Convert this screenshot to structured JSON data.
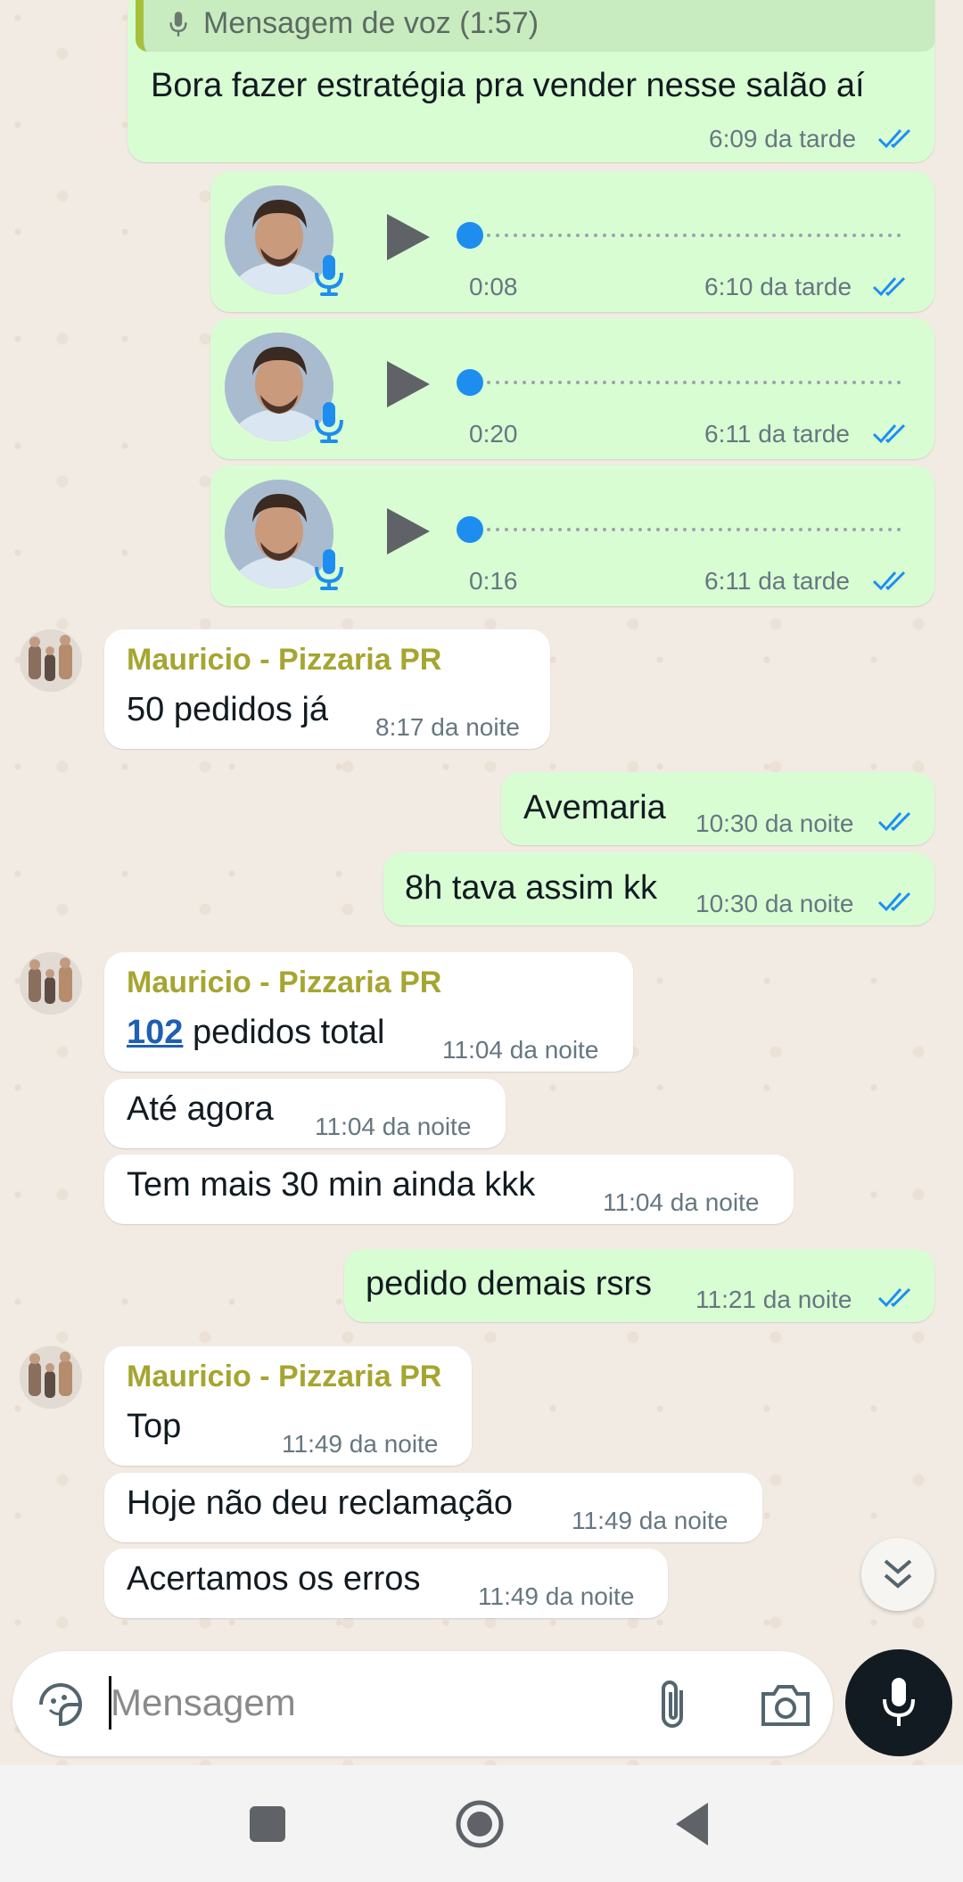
{
  "messages": {
    "quoted_voice": "Mensagem de voz (1:57)",
    "m1_text": "Bora fazer estratégia pra vender nesse salão aí",
    "m1_time": "6:09 da tarde",
    "voice1": {
      "duration": "0:08",
      "time": "6:10 da tarde"
    },
    "voice2": {
      "duration": "0:20",
      "time": "6:11 da tarde"
    },
    "voice3": {
      "duration": "0:16",
      "time": "6:11 da tarde"
    },
    "g1_sender": "Mauricio - Pizzaria PR",
    "g1_text": "50 pedidos já",
    "g1_time": "8:17 da noite",
    "o1_text": "Avemaria",
    "o1_time": "10:30 da noite",
    "o2_text": "8h tava assim kk",
    "o2_time": "10:30 da noite",
    "g2_sender": "Mauricio - Pizzaria PR",
    "g2_link": "102",
    "g2_text": " pedidos total",
    "g2_time": "11:04 da noite",
    "g3_text": "Até agora",
    "g3_time": "11:04 da noite",
    "g4_text": "Tem mais 30 min ainda kkk",
    "g4_time": "11:04 da noite",
    "o3_text": "pedido demais rsrs",
    "o3_time": "11:21 da noite",
    "g5_sender": "Mauricio - Pizzaria PR",
    "g5_text": "Top",
    "g5_time": "11:49 da noite",
    "g6_text": "Hoje não deu reclamação",
    "g6_time": "11:49 da noite",
    "g7_text": "Acertamos os erros",
    "g7_time": "11:49 da noite"
  },
  "composer": {
    "placeholder": "Mensagem"
  },
  "icons": [
    "mic-icon",
    "play-icon",
    "double-check-icon",
    "sticker-icon",
    "attach-icon",
    "camera-icon",
    "scroll-down-icon",
    "nav-recent-icon",
    "nav-home-icon",
    "nav-back-icon"
  ],
  "colors": {
    "outgoing_bubble": "#d9fdd3",
    "incoming_bubble": "#ffffff",
    "sender_name": "#a5a531",
    "read_ticks": "#1d8ef0"
  }
}
